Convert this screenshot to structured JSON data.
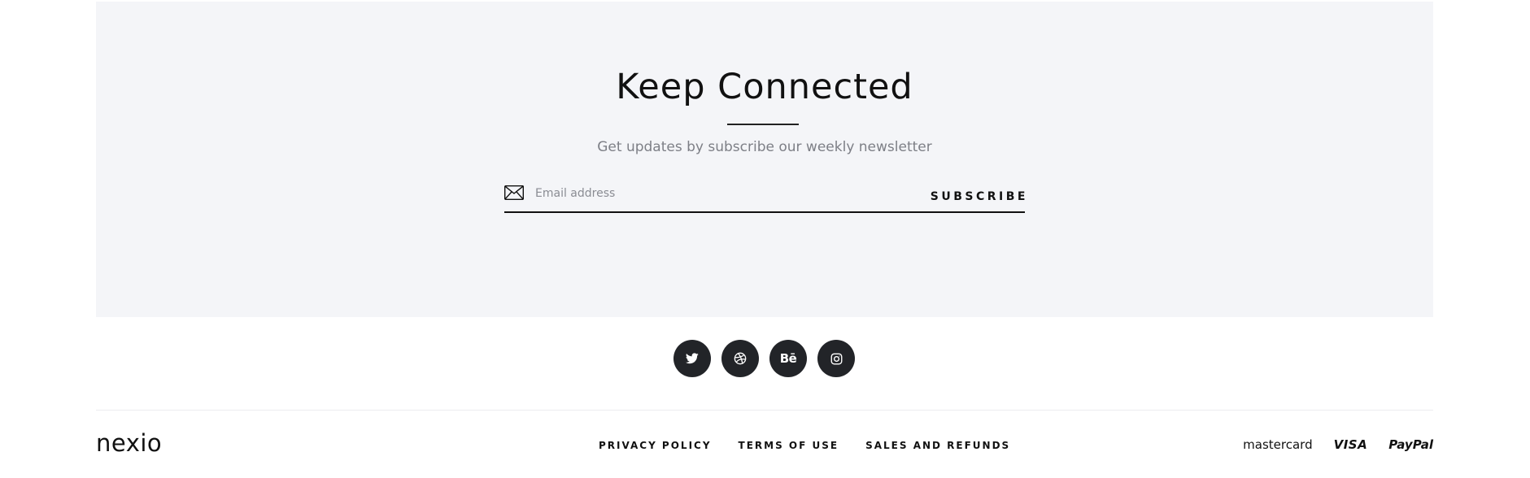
{
  "newsletter": {
    "title": "Keep Connected",
    "subtitle": "Get updates by subscribe our weekly newsletter",
    "email_placeholder": "Email address",
    "subscribe_label": "SUBSCRIBE"
  },
  "social": [
    {
      "name": "twitter",
      "icon": "twitter-icon"
    },
    {
      "name": "dribbble",
      "icon": "dribbble-icon"
    },
    {
      "name": "behance",
      "icon": "behance-icon",
      "text": "Bē"
    },
    {
      "name": "instagram",
      "icon": "instagram-icon"
    }
  ],
  "footer": {
    "logo": "nexio",
    "links": [
      "PRIVACY POLICY",
      "TERMS OF USE",
      "SALES AND REFUNDS"
    ],
    "payments": [
      "mastercard",
      "VISA",
      "PayPal"
    ]
  },
  "colors": {
    "newsletter_bg": "#f4f5f8",
    "social_bg": "#222428",
    "text": "#111111",
    "muted": "#7d7f86"
  }
}
